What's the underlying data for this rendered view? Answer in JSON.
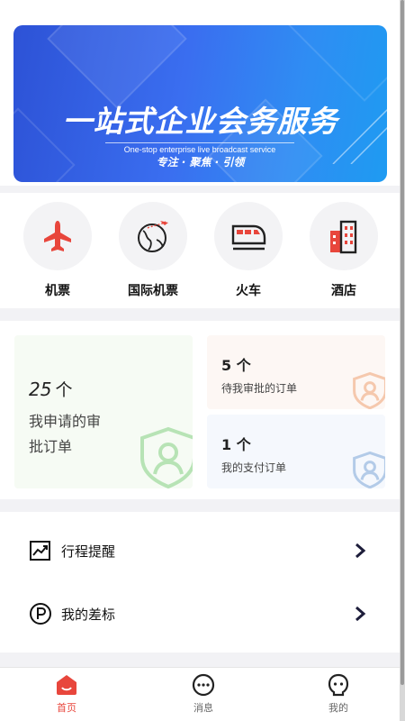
{
  "banner": {
    "title": "一站式企业会务服务",
    "subtitle": "One-stop enterprise live broadcast service",
    "slogan": "专注 · 聚焦 · 引领"
  },
  "services": [
    {
      "label": "机票",
      "icon": "airplane-icon"
    },
    {
      "label": "国际机票",
      "icon": "globe-plane-icon"
    },
    {
      "label": "火车",
      "icon": "train-icon"
    },
    {
      "label": "酒店",
      "icon": "hotel-building-icon"
    }
  ],
  "approvals": {
    "mine": {
      "count": "25",
      "unit": "个",
      "label": "我申请的审批订单"
    },
    "pending": {
      "count": "5 个",
      "label": "待我审批的订单"
    },
    "payment": {
      "count": "1 个",
      "label": "我的支付订单"
    }
  },
  "menu": [
    {
      "label": "行程提醒",
      "icon": "trend-chart-icon"
    },
    {
      "label": "我的差标",
      "icon": "parking-circle-icon"
    }
  ],
  "tabbar": [
    {
      "label": "首页",
      "icon": "home-icon",
      "active": true
    },
    {
      "label": "消息",
      "icon": "chat-bubble-icon",
      "active": false
    },
    {
      "label": "我的",
      "icon": "user-profile-icon",
      "active": false
    }
  ],
  "colors": {
    "accent": "#e8463c",
    "banner_start": "#2d52d6",
    "banner_end": "#1e9bf2"
  }
}
